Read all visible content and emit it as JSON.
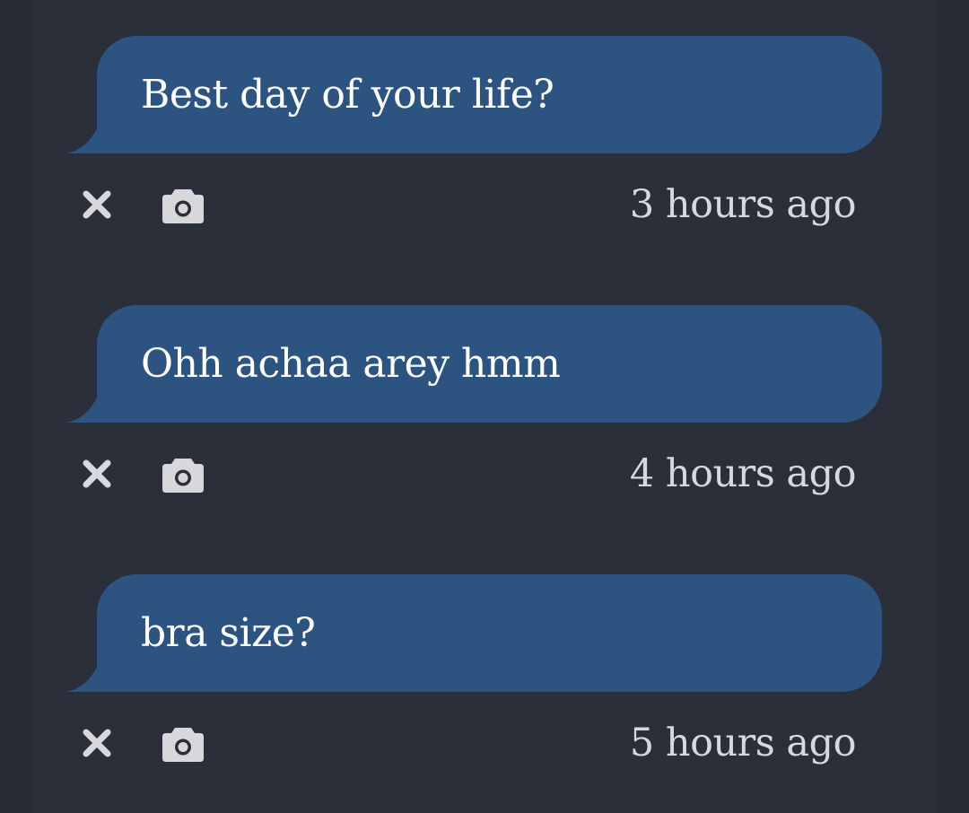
{
  "colors": {
    "background": "#272b33",
    "panel": "#2b2f3a",
    "bubble": "#2d5380",
    "bubble_text": "#ffffff",
    "meta_text": "#d8d8dc"
  },
  "messages": [
    {
      "text": "Best day of your life?",
      "timestamp": "3 hours ago",
      "actions": [
        "close-icon",
        "camera-icon"
      ]
    },
    {
      "text": "Ohh achaa arey hmm",
      "timestamp": "4 hours ago",
      "actions": [
        "close-icon",
        "camera-icon"
      ]
    },
    {
      "text": "bra size?",
      "timestamp": "5 hours ago",
      "actions": [
        "close-icon",
        "camera-icon"
      ]
    }
  ]
}
